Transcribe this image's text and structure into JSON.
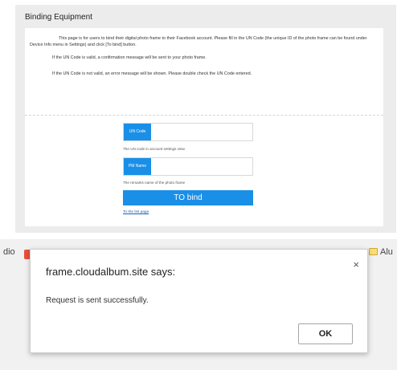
{
  "binding_page": {
    "title": "Binding Equipment",
    "intro": {
      "paragraph_1": "This page is for users to bind their digital photo frame to their Facebook account. Please fill in the UN Code (the unique ID of the photo frame can be found under Device Info menu in Settings) and click [To bind] button.",
      "paragraph_2": "If the UN Code is valid, a confirmation message will be sent to your photo frame.",
      "paragraph_3": "If the UN Code is not valid, an error message will be shown. Please double check the UN Code entered."
    },
    "un_code_field": {
      "label": "UN Code",
      "value": "",
      "hint": "The UN code in account settings view."
    },
    "frame_name_field": {
      "label": "PM Name",
      "value": "",
      "hint": "The remarks name of the photo frame"
    },
    "bind_button": "TO bind",
    "list_link": "To the list page"
  },
  "browser": {
    "bookmark_left": "dio",
    "bookmark_right": "Alu"
  },
  "dialog": {
    "title": "frame.cloudalbum.site says:",
    "close_symbol": "×",
    "message": "Request is sent successfully.",
    "ok_label": "OK"
  },
  "colors": {
    "accent_blue": "#1a8fe8",
    "link_blue": "#1a5fb4"
  }
}
